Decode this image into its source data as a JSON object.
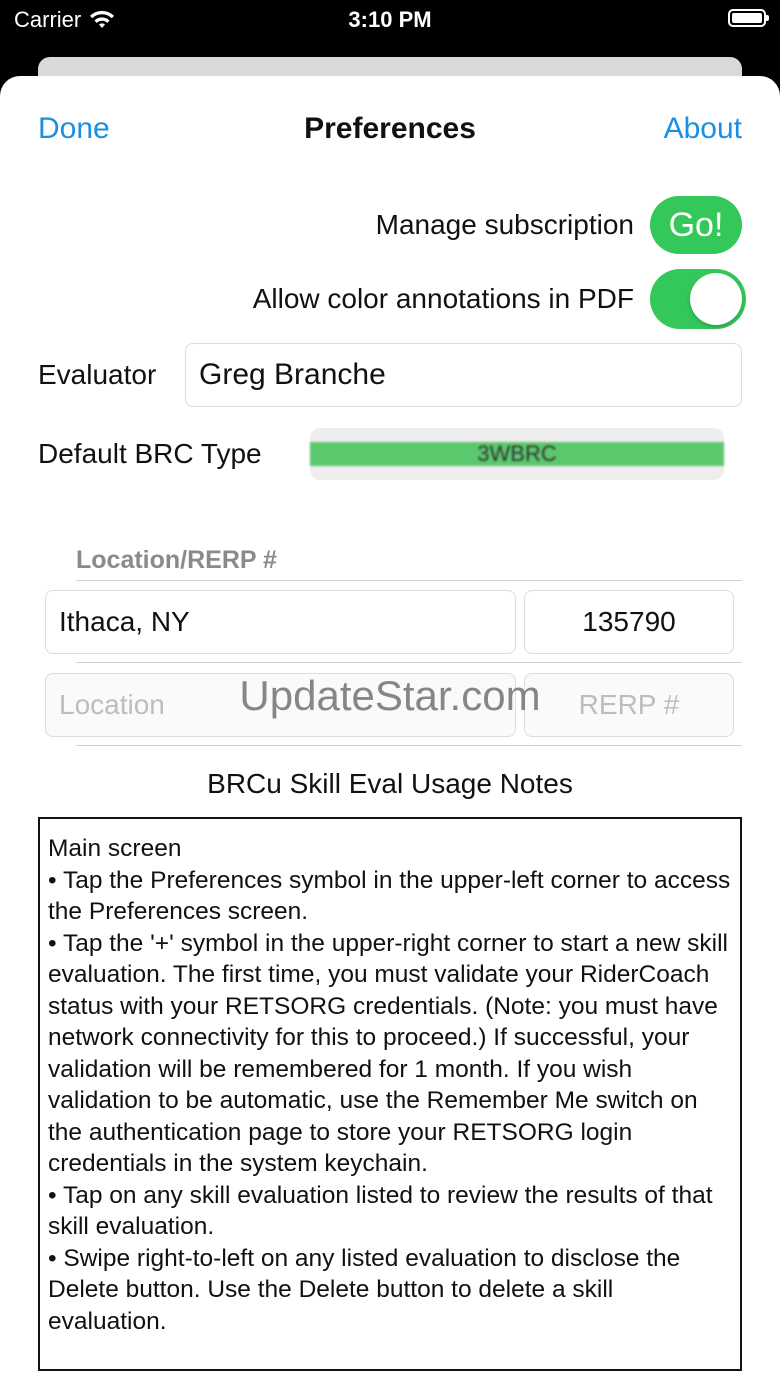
{
  "status": {
    "carrier": "Carrier",
    "time": "3:10 PM"
  },
  "nav": {
    "done": "Done",
    "title": "Preferences",
    "about": "About"
  },
  "prefs": {
    "manage_subscription": "Manage subscription",
    "go": "Go!",
    "allow_color": "Allow color annotations in PDF",
    "allow_color_on": true,
    "evaluator_label": "Evaluator",
    "evaluator_value": "Greg Branche",
    "default_brc_label": "Default BRC Type",
    "default_brc_value": "3WBRC"
  },
  "locations": {
    "header": "Location/RERP #",
    "row1": {
      "location": "Ithaca, NY",
      "rerp": "135790"
    },
    "row2": {
      "location_placeholder": "Location",
      "rerp_placeholder": "RERP #"
    }
  },
  "watermark": "UpdateStar.com",
  "notes": {
    "title": "BRCu Skill Eval Usage Notes",
    "lines": [
      "Main screen",
      "• Tap the Preferences symbol in the upper-left corner to access the Preferences screen.",
      "• Tap the '+' symbol in the upper-right corner to start a new skill evaluation. The first time, you must validate your RiderCoach status with your RETSORG credentials. (Note: you must have network connectivity for this to proceed.) If successful, your validation will be remembered for 1 month. If you wish validation to be automatic, use the Remember Me switch on the authentication page to store your RETSORG login credentials in the system keychain.",
      "• Tap on any skill evaluation listed to review the results of that skill evaluation.",
      "• Swipe right-to-left on any listed evaluation to disclose the Delete button. Use the Delete button to delete a skill evaluation."
    ]
  },
  "colors": {
    "accent": "#1a8fe3",
    "green": "#34c759"
  }
}
